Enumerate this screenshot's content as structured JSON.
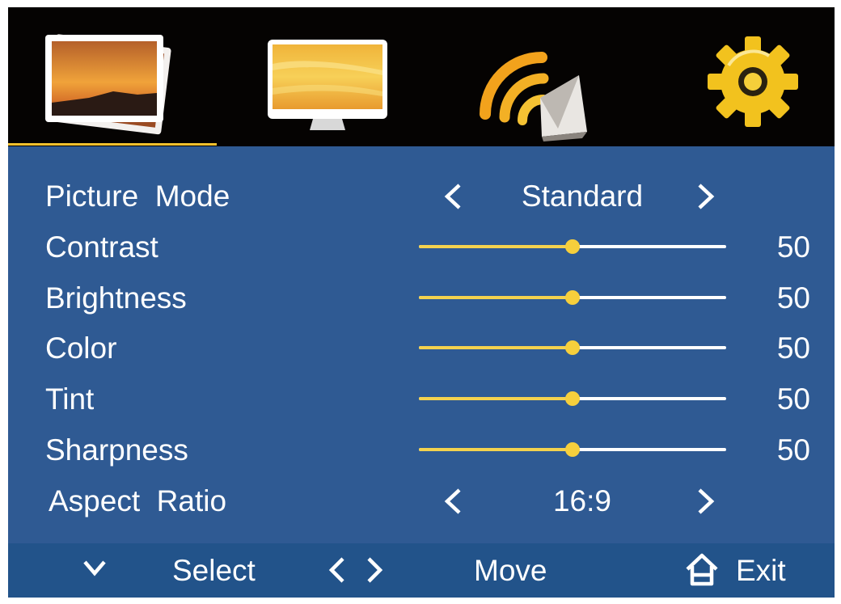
{
  "tabs": [
    {
      "name": "Picture",
      "icon": "picture-photos-icon",
      "selected": true
    },
    {
      "name": "Screen",
      "icon": "monitor-screen-icon",
      "selected": false
    },
    {
      "name": "Sound",
      "icon": "speaker-sound-icon",
      "selected": false
    },
    {
      "name": "Settings",
      "icon": "gear-icon",
      "selected": false
    }
  ],
  "menu": {
    "picture_mode": {
      "label": "Picture  Mode",
      "value": "Standard"
    },
    "contrast": {
      "label": "Contrast",
      "value": "50",
      "level": 50
    },
    "brightness": {
      "label": "Brightness",
      "value": "50",
      "level": 50
    },
    "color": {
      "label": "Color",
      "value": "50",
      "level": 50
    },
    "tint": {
      "label": "Tint",
      "value": "50",
      "level": 50
    },
    "sharpness": {
      "label": "Sharpness",
      "value": "50",
      "level": 50
    },
    "aspect_ratio": {
      "label": "Aspect  Ratio",
      "value": "16:9"
    }
  },
  "hints": {
    "select": "Select",
    "move": "Move",
    "exit": "Exit"
  },
  "colors": {
    "panel": "#2f5a93",
    "hint_bar": "#22538a",
    "tab_bar": "#050302",
    "accent": "#f4d24e"
  }
}
